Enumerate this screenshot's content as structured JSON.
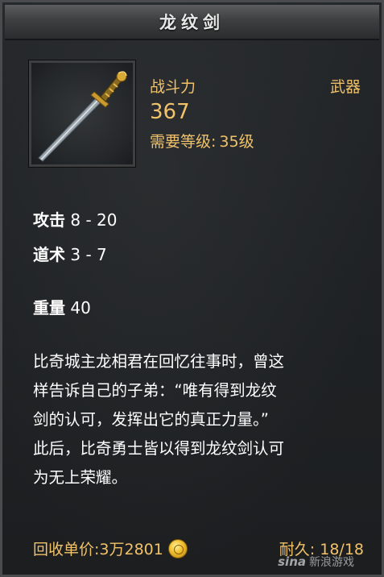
{
  "item": {
    "name": "龙纹剑",
    "type": "武器",
    "power_label": "战斗力",
    "power_value": "367",
    "required_level_label": "需要等级:",
    "required_level_value": "35级"
  },
  "attributes": [
    {
      "label": "攻击",
      "value": "8 - 20"
    },
    {
      "label": "道术",
      "value": "3 - 7"
    },
    {
      "label": "重量",
      "value": "40"
    }
  ],
  "lore": "比奇城主龙相君在回忆往事时，曾这\n样告诉自己的子弟：“唯有得到龙纹\n剑的认可，发挥出它的真正力量。”\n此后，比奇勇士皆以得到龙纹剑认可\n为无上荣耀。",
  "footer": {
    "recycle_label": "回收单价:",
    "recycle_value": "3万2801",
    "durability_label": "耐久:",
    "durability_value": "18/18"
  },
  "watermark": {
    "logo": "sina",
    "text": "新浪游戏"
  },
  "icons": {
    "item_icon": "sword-icon",
    "currency_icon": "gold-coin-icon"
  },
  "colors": {
    "accent_gold": "#f1c26a",
    "text_white": "#ffffff",
    "panel_bg": "#1f2224"
  }
}
